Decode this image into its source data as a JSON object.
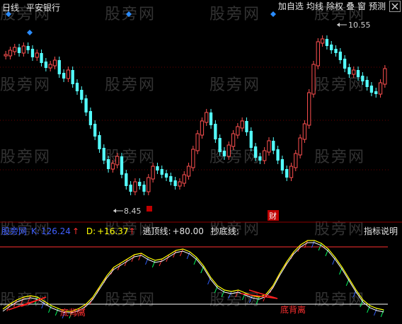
{
  "header": {
    "period": "日线",
    "stock_name": "平安银行"
  },
  "toolbar": {
    "items": [
      "加自选",
      "均线",
      "除权",
      "叠",
      "窗",
      "预测"
    ],
    "close_icon": "close-icon"
  },
  "price_panel": {
    "high_label": "10.55",
    "low_label": "8.45",
    "marker_label": "财",
    "up_color": "#ff5050",
    "down_color": "#54ffff"
  },
  "indicator_panel": {
    "name": "股旁网",
    "k_label": "K:",
    "k_value": "126.24",
    "d_label": "D:",
    "d_value": "+16.37",
    "top_line_label": "逃顶线:",
    "top_line_value": "+80.00",
    "bottom_line_label": "抄底线:",
    "explain_label": "指标说明",
    "divergence_labels": [
      "底背离",
      "底背离"
    ]
  },
  "watermark": "股旁网",
  "colors": {
    "background": "#000000",
    "grid_dotted": "#8b0000",
    "k_line": "#ffff00",
    "d_line": "#ffffff",
    "top_line": "#ff3030",
    "bottom_line": "#ffffff"
  }
}
